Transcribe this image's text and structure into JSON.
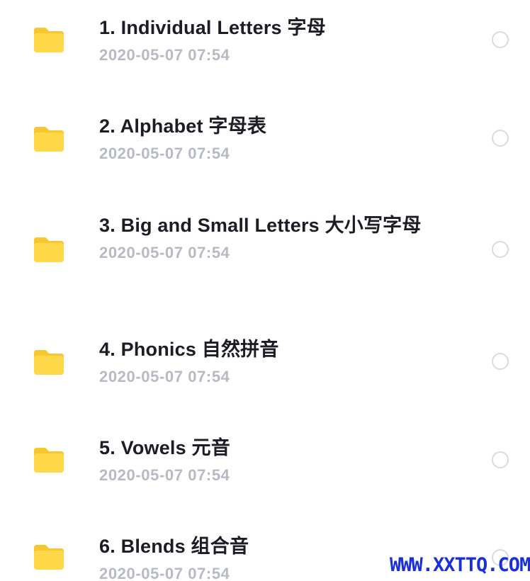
{
  "items": [
    {
      "title": "1. Individual Letters 字母",
      "date": "2020-05-07 07:54",
      "icon": "folder-icon"
    },
    {
      "title": "2. Alphabet 字母表",
      "date": "2020-05-07 07:54",
      "icon": "folder-icon"
    },
    {
      "title": "3. Big and Small Letters 大小写字母",
      "date": "2020-05-07 07:54",
      "icon": "folder-icon"
    },
    {
      "title": "4. Phonics 自然拼音",
      "date": "2020-05-07 07:54",
      "icon": "folder-icon"
    },
    {
      "title": "5. Vowels 元音",
      "date": "2020-05-07 07:54",
      "icon": "folder-icon"
    },
    {
      "title": "6. Blends 组合音",
      "date": "2020-05-07 07:54",
      "icon": "folder-icon"
    }
  ],
  "watermark": "WWW.XXTTQ.COM",
  "colors": {
    "folder": "#FFD84A",
    "folder_tab": "#F7C631",
    "title": "#1b1c24",
    "date": "#b7bac3",
    "watermark": "#1a2fd8"
  }
}
